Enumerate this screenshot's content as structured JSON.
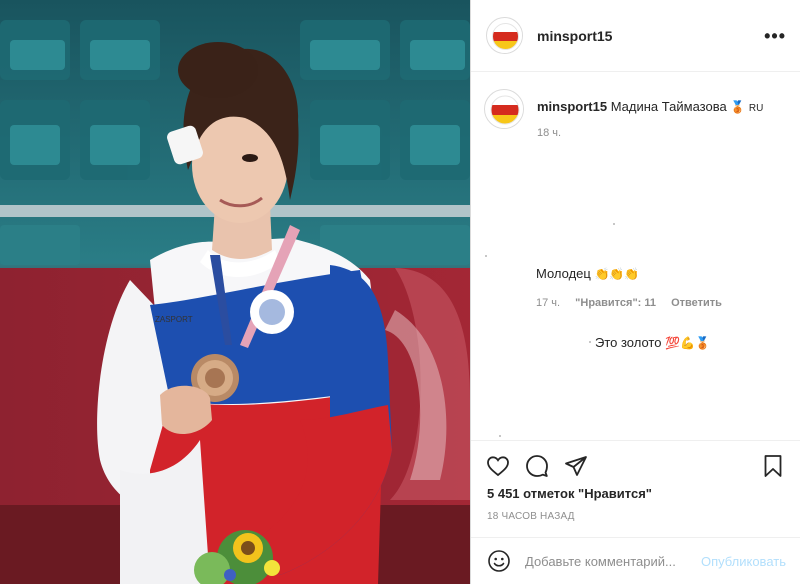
{
  "post": {
    "username": "minsport15",
    "more_icon": "ellipsis-icon"
  },
  "caption": {
    "username": "minsport15",
    "text": "Мадина Таймазова",
    "emoji": "🥉",
    "suffix": "RU",
    "time": "18 ч."
  },
  "comments": [
    {
      "text": "Молодец",
      "emoji": "👏👏👏",
      "time": "17 ч.",
      "likes": "\"Нравится\": 11",
      "reply": "Ответить"
    },
    {
      "text": "Это золото",
      "emoji": "💯💪🥉"
    }
  ],
  "actions": {
    "icons": [
      "heart-icon",
      "comment-icon",
      "share-icon",
      "bookmark-icon"
    ]
  },
  "likes_text": "5 451 отметок \"Нравится\"",
  "time_ago": "18 ЧАСОВ НАЗАД",
  "add_comment": {
    "placeholder": "Добавьте комментарий...",
    "publish": "Опубликовать"
  },
  "colors": {
    "link_disabled": "#b2dffc",
    "secondary_text": "#8e8e8e",
    "primary_text": "#262626"
  }
}
